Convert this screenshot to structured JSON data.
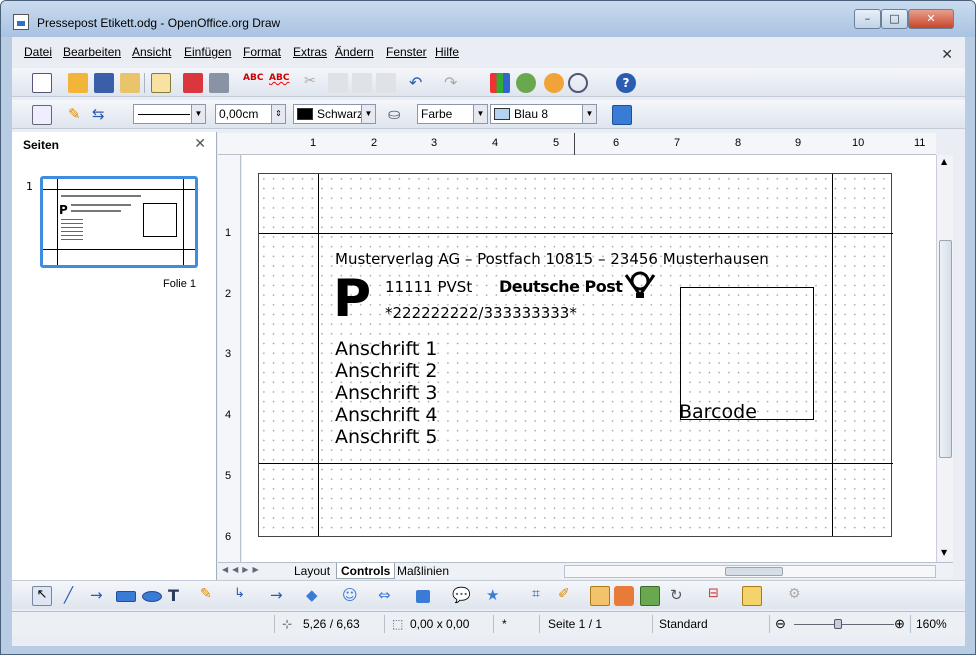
{
  "window": {
    "title": "Pressepost Etikett.odg - OpenOffice.org Draw",
    "minimize": "–",
    "maximize": "□",
    "close": "✕"
  },
  "menu": [
    "Datei",
    "Bearbeiten",
    "Ansicht",
    "Einfügen",
    "Format",
    "Extras",
    "Ändern",
    "Fenster",
    "Hilfe"
  ],
  "lineprops": {
    "line_width": "0,00cm",
    "line_color": "Schwarz",
    "area_style": "Farbe",
    "area_color": "Blau 8"
  },
  "sidebar": {
    "title": "Seiten",
    "slide_number": "1",
    "slide_label": "Folie 1"
  },
  "ruler_h": [
    "1",
    "2",
    "3",
    "4",
    "5",
    "6",
    "7",
    "8",
    "9",
    "10",
    "11"
  ],
  "ruler_v": [
    "1",
    "2",
    "3",
    "4",
    "5",
    "6"
  ],
  "document": {
    "sender": "Musterverlag AG – Postfach 10815 – 23456 Musterhausen",
    "p_mark": "P",
    "pvst": "11111 PVSt",
    "brand": "Deutsche Post",
    "code": "*222222222/333333333*",
    "addresses": [
      "Anschrift 1",
      "Anschrift 2",
      "Anschrift 3",
      "Anschrift 4",
      "Anschrift 5"
    ],
    "barcode": "Barcode"
  },
  "tabs": [
    "Layout",
    "Controls",
    "Maßlinien"
  ],
  "active_tab": "Controls",
  "status": {
    "position": "5,26 / 6,63",
    "size": "0,00 x 0,00",
    "modified": "*",
    "page": "Seite 1 / 1",
    "layout": "Standard",
    "zoom": "160%"
  },
  "icons": {
    "toolbar1": [
      "new-icon",
      "open-icon",
      "save-icon",
      "email-icon",
      "edit-file-icon",
      "pdf-icon",
      "print-icon",
      "spellcheck-icon",
      "autospell-icon",
      "cut-icon",
      "copy-icon",
      "paste-icon",
      "format-paintbrush-icon",
      "undo-icon",
      "redo-icon",
      "chart-icon",
      "gallery-icon",
      "navigator-icon",
      "zoom-icon",
      "help-icon"
    ],
    "drawing": [
      "select-icon",
      "line-icon",
      "arrow-line-icon",
      "rectangle-icon",
      "ellipse-icon",
      "text-icon",
      "curve-icon",
      "connector-icon",
      "lines-arrows-icon",
      "basic-shapes-icon",
      "symbol-shapes-icon",
      "block-arrows-icon",
      "flowchart-icon",
      "callouts-icon",
      "stars-icon",
      "points-icon",
      "glue-points-icon",
      "fontwork-icon",
      "from-file-icon",
      "gallery-icon",
      "rotate-icon",
      "align-icon",
      "arrange-icon",
      "extrusion-icon"
    ]
  }
}
